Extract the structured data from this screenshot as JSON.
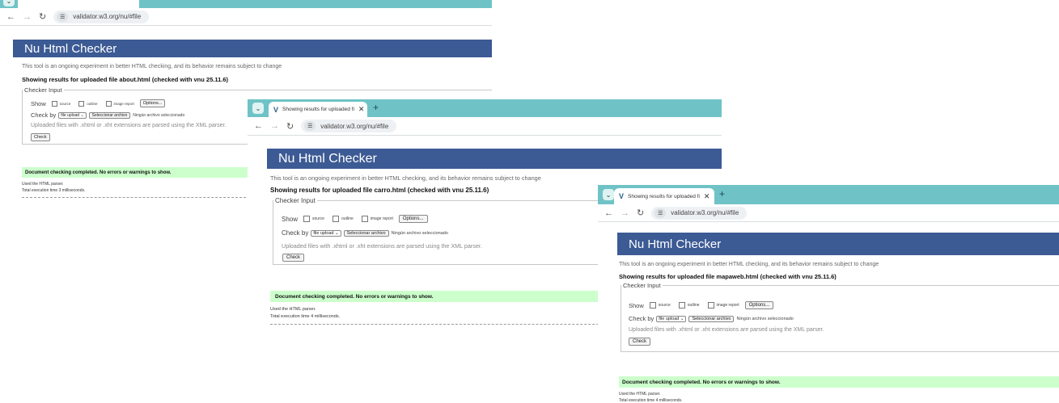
{
  "screenshots": [
    {
      "tab_title": "",
      "url": "validator.w3.org/nu/#file",
      "header": "Nu Html Checker",
      "intro": "This tool is an ongoing experiment in better HTML checking, and its behavior remains subject to change",
      "showing": "Showing results for uploaded file about.html (checked with vnu 25.11.6)",
      "legend": "Checker Input",
      "show_label": "Show",
      "opt_source": "source",
      "opt_outline": "outline",
      "opt_image_report": "image report",
      "options_button": "Options...",
      "check_by_label": "Check by",
      "check_by_value": "file upload",
      "choose_file_button": "Seleccionar archivo",
      "no_file": "Ningún archivo seleccionado",
      "upload_note": "Uploaded files with .xhtml or .xht extensions are parsed using the XML parser.",
      "check_button": "Check",
      "success": "Document checking completed. No errors or warnings to show.",
      "detail_parser": "Used the HTML parser.",
      "detail_time": "Total execution time 3 milliseconds."
    },
    {
      "tab_title": "Showing results for uploaded fi",
      "url": "validator.w3.org/nu/#file",
      "header": "Nu Html Checker",
      "intro": "This tool is an ongoing experiment in better HTML checking, and its behavior remains subject to change",
      "showing": "Showing results for uploaded file carro.html (checked with vnu 25.11.6)",
      "legend": "Checker Input",
      "show_label": "Show",
      "opt_source": "source",
      "opt_outline": "outline",
      "opt_image_report": "image report",
      "options_button": "Options...",
      "check_by_label": "Check by",
      "check_by_value": "file upload",
      "choose_file_button": "Seleccionar archivo",
      "no_file": "Ningún archivo seleccionado",
      "upload_note": "Uploaded files with .xhtml or .xht extensions are parsed using the XML parser.",
      "check_button": "Check",
      "success": "Document checking completed. No errors or warnings to show.",
      "detail_parser": "Used the HTML parser.",
      "detail_time": "Total execution time 4 milliseconds."
    },
    {
      "tab_title": "Showing results for uploaded fi",
      "url": "validator.w3.org/nu/#file",
      "header": "Nu Html Checker",
      "intro": "This tool is an ongoing experiment in better HTML checking, and its behavior remains subject to change",
      "showing": "Showing results for uploaded file mapaweb.html (checked with vnu 25.11.6)",
      "legend": "Checker Input",
      "show_label": "Show",
      "opt_source": "source",
      "opt_outline": "outline",
      "opt_image_report": "image report",
      "options_button": "Options...",
      "check_by_label": "Check by",
      "check_by_value": "file upload",
      "choose_file_button": "Seleccionar archivo",
      "no_file": "Ningún archivo seleccionado",
      "upload_note": "Uploaded files with .xhtml or .xht extensions are parsed using the XML parser.",
      "check_button": "Check",
      "success": "Document checking completed. No errors or warnings to show.",
      "detail_parser": "Used the HTML parser.",
      "detail_time": "Total execution time 4 milliseconds."
    }
  ],
  "icons": {
    "back": "arrow-left",
    "forward": "arrow-right",
    "reload": "reload",
    "site_info": "tune",
    "favicon": "w3c-v-logo",
    "close_tab": "x",
    "new_tab": "plus",
    "tab_list": "chevron-down"
  },
  "colors": {
    "tabstrip": "#6fc3c6",
    "banner": "#3c5a94",
    "success_bg": "#ccffcc"
  }
}
